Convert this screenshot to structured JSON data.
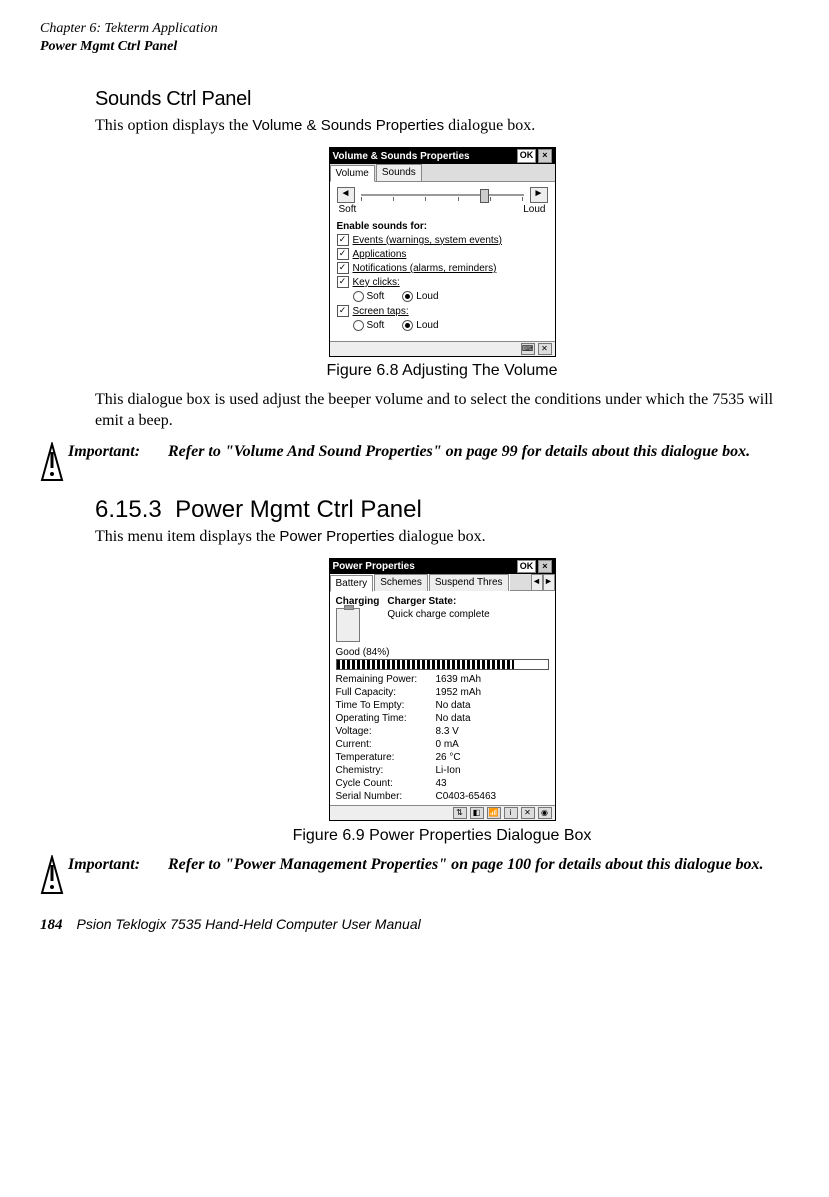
{
  "header": {
    "chapter": "Chapter 6: Tekterm Application",
    "section": "Power Mgmt Ctrl Panel"
  },
  "sounds": {
    "heading": "Sounds Ctrl Panel",
    "intro_1": "This option displays the",
    "intro_ui": "Volume & Sounds Properties",
    "intro_2": "dialogue box."
  },
  "vol_dialog": {
    "title": "Volume & Sounds Properties",
    "ok": "OK",
    "close": "×",
    "tab1": "Volume",
    "tab2": "Sounds",
    "soft": "Soft",
    "loud": "Loud",
    "left": "◄",
    "right": "►",
    "enable": "Enable sounds for:",
    "chk1": "Events (warnings, system events)",
    "chk2": "Applications",
    "chk3": "Notifications (alarms, reminders)",
    "chk4": "Key clicks:",
    "chk5": "Screen taps:",
    "rsoft": "Soft",
    "rloud": "Loud"
  },
  "fig1_caption": "Figure 6.8 Adjusting The Volume",
  "after_fig1": "This dialogue box is used adjust the beeper volume and to select the conditions under which the 7535 will emit a beep.",
  "important_label": "Important:",
  "important1": "Refer to \"Volume And Sound Properties\" on page 99 for details about this dialogue box.",
  "sec_num": "6.15.3",
  "sec_title": "Power Mgmt Ctrl Panel",
  "sec_intro_1": "This menu item displays the",
  "sec_intro_ui": "Power Properties",
  "sec_intro_2": "dialogue box.",
  "pwr_dialog": {
    "title": "Power Properties",
    "ok": "OK",
    "close": "×",
    "tab1": "Battery",
    "tab2": "Schemes",
    "tab3": "Suspend Thres",
    "left": "◄",
    "right": "►",
    "charging": "Charging",
    "charger_state": "Charger State:",
    "charger_val": "Quick charge complete",
    "good_pct": "Good  (84%)",
    "stats": [
      {
        "k": "Remaining Power:",
        "v": "1639 mAh"
      },
      {
        "k": "Full Capacity:",
        "v": "1952 mAh"
      },
      {
        "k": "Time To Empty:",
        "v": "No data"
      },
      {
        "k": "Operating Time:",
        "v": "No data"
      },
      {
        "k": "Voltage:",
        "v": "8.3 V"
      },
      {
        "k": "Current:",
        "v": "0 mA"
      },
      {
        "k": "Temperature:",
        "v": "26 °C"
      },
      {
        "k": "Chemistry:",
        "v": "Li-Ion"
      },
      {
        "k": "Cycle Count:",
        "v": "43"
      },
      {
        "k": "Serial Number:",
        "v": "C0403-65463"
      }
    ]
  },
  "fig2_caption": "Figure 6.9 Power Properties Dialogue Box",
  "important2": "Refer to \"Power Management Properties\" on page 100 for details about this dialogue box.",
  "footer": {
    "page": "184",
    "text": "Psion Teklogix 7535 Hand-Held Computer User Manual"
  }
}
